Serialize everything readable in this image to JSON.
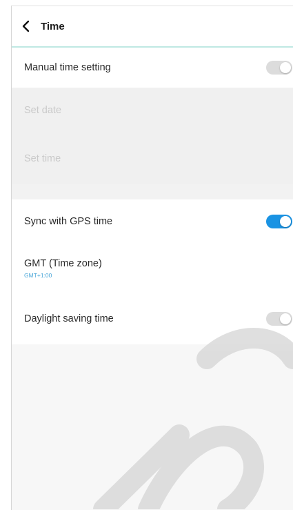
{
  "header": {
    "title": "Time"
  },
  "settings": {
    "manual_time": {
      "label": "Manual time setting",
      "enabled": false
    },
    "set_date": {
      "label": "Set date",
      "value": ""
    },
    "set_time": {
      "label": "Set time",
      "value": ""
    },
    "sync_gps": {
      "label": "Sync with GPS time",
      "enabled": true
    },
    "timezone": {
      "label": "GMT (Time zone)",
      "value": "GMT+1:00"
    },
    "daylight": {
      "label": "Daylight saving time",
      "enabled": false
    }
  },
  "colors": {
    "accent": "#1a93e3",
    "header_divider": "#bfe8e3",
    "toggle_off": "#dcdcdc"
  }
}
